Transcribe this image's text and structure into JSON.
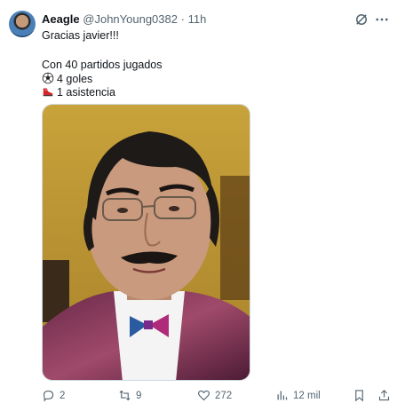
{
  "tweet": {
    "display_name": "Aeagle",
    "handle": "@JohnYoung0382",
    "separator": "·",
    "time": "11h",
    "lines": {
      "greeting": "Gracias javier!!!",
      "matches": "Con 40 partidos jugados",
      "goals": "4 goles",
      "assists": "1 asistencia"
    },
    "icons": {
      "goals": "soccer-ball-icon",
      "assists": "soccer-boot-icon"
    },
    "media": {
      "description_icon": "meme-photo"
    },
    "actions": {
      "replies": "2",
      "reposts": "9",
      "likes": "272",
      "views": "12 mil"
    }
  },
  "colors": {
    "text": "#0f1419",
    "secondary": "#536471",
    "border": "#cfd9de"
  }
}
